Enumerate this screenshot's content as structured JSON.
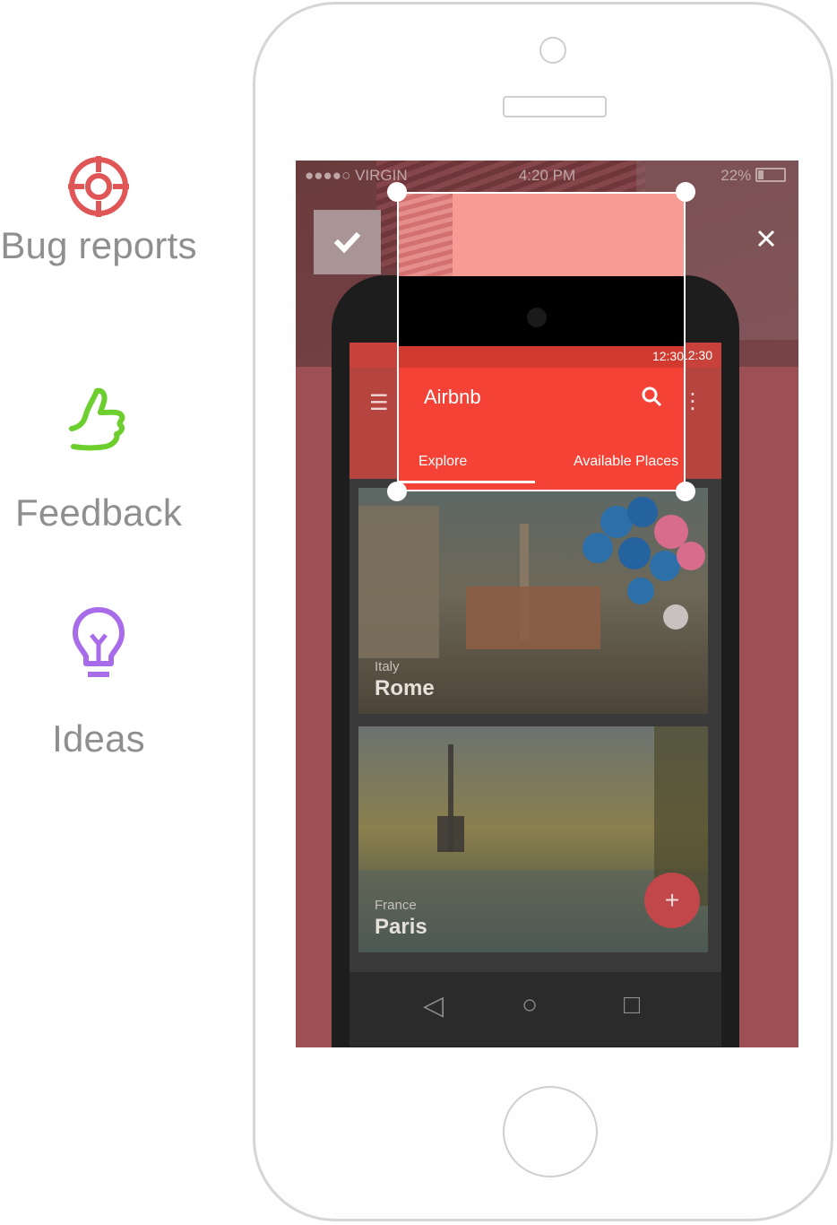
{
  "features": [
    {
      "label": "Bug reports",
      "icon": "crosshair-icon",
      "color": "#e05555"
    },
    {
      "label": "Feedback",
      "icon": "thumbs-up-icon",
      "color": "#6ccf2d"
    },
    {
      "label": "Ideas",
      "icon": "lightbulb-icon",
      "color": "#a86bea"
    }
  ],
  "status_bar": {
    "carrier": "●●●●○ VIRGIN",
    "time": "4:20 PM",
    "battery": "22%"
  },
  "annotation": {
    "confirm_icon": "checkmark-icon",
    "close_icon": "close-icon"
  },
  "app": {
    "android_time": "12:30",
    "title": "Airbnb",
    "tabs": [
      "Explore",
      "Available Places"
    ],
    "cards": [
      {
        "country": "Italy",
        "city": "Rome"
      },
      {
        "country": "France",
        "city": "Paris"
      }
    ],
    "fab_label": "+"
  }
}
